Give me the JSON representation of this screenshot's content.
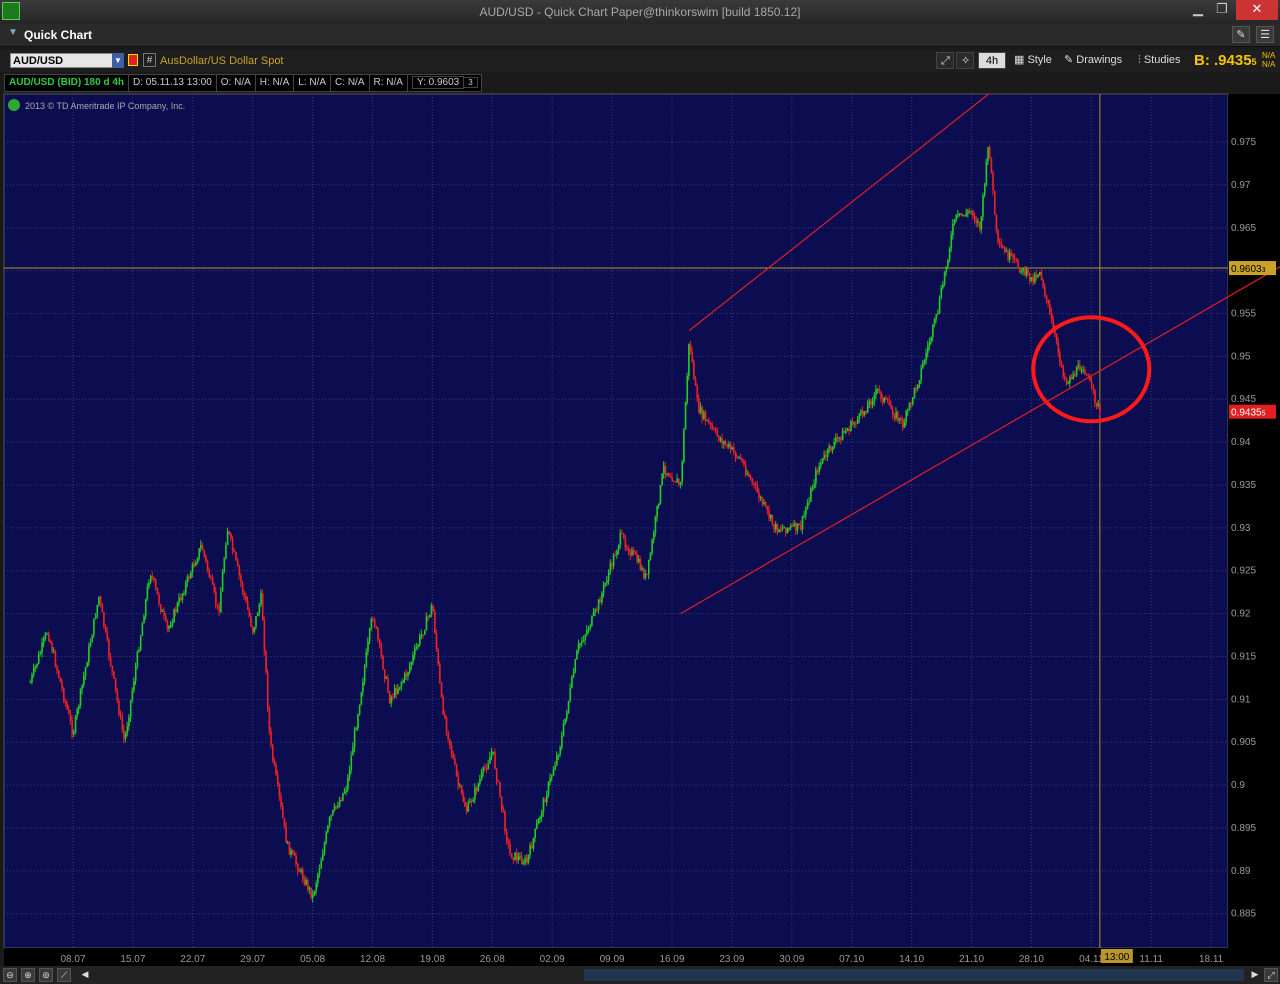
{
  "window": {
    "title": "AUD/USD - Quick Chart Paper@thinkorswim [build 1850.12]"
  },
  "header": {
    "label": "Quick Chart"
  },
  "toolbar": {
    "symbol": "AUD/USD",
    "description": "AusDollar/US Dollar Spot",
    "timeframe": "4h",
    "style_label": "Style",
    "drawings_label": "Drawings",
    "studies_label": "Studies",
    "bid_label": "B:",
    "bid_value": ".9435",
    "bid_sub": "5",
    "na_top": "N/A",
    "na_bottom": "N/A"
  },
  "info": {
    "symbol": "AUD/USD (BID) 180 d 4h",
    "date": "D: 05.11.13 13:00",
    "open": "O: N/A",
    "high": "H: N/A",
    "low": "L: N/A",
    "close": "C: N/A",
    "range": "R: N/A",
    "y": "Y: 0.9603",
    "y_sub": "3"
  },
  "copyright": "2013 © TD Ameritrade IP Company, Inc.",
  "chart_data": {
    "type": "candlestick",
    "x_tick_labels": [
      "08.07",
      "15.07",
      "22.07",
      "29.07",
      "05.08",
      "12.08",
      "19.08",
      "26.08",
      "02.09",
      "09.09",
      "16.09",
      "23.09",
      "30.09",
      "07.10",
      "14.10",
      "21.10",
      "28.10",
      "04.11",
      "11.11",
      "18.11"
    ],
    "y_tick_labels": [
      "0.885",
      "0.89",
      "0.895",
      "0.9",
      "0.905",
      "0.91",
      "0.915",
      "0.92",
      "0.925",
      "0.93",
      "0.935",
      "0.94",
      "0.945",
      "0.95",
      "0.955",
      "0.96",
      "0.965",
      "0.97",
      "0.975"
    ],
    "ylim": [
      0.881,
      0.9806
    ],
    "close_path": [
      {
        "x": "03.07",
        "y": 0.912
      },
      {
        "x": "05.07",
        "y": 0.918
      },
      {
        "x": "08.07",
        "y": 0.906
      },
      {
        "x": "11.07",
        "y": 0.922
      },
      {
        "x": "14.07",
        "y": 0.905
      },
      {
        "x": "17.07",
        "y": 0.925
      },
      {
        "x": "19.07",
        "y": 0.918
      },
      {
        "x": "23.07",
        "y": 0.928
      },
      {
        "x": "25.07",
        "y": 0.92
      },
      {
        "x": "26.07",
        "y": 0.93
      },
      {
        "x": "29.07",
        "y": 0.918
      },
      {
        "x": "30.07",
        "y": 0.922
      },
      {
        "x": "31.07",
        "y": 0.905
      },
      {
        "x": "01.08",
        "y": 0.899
      },
      {
        "x": "02.08",
        "y": 0.893
      },
      {
        "x": "05.08",
        "y": 0.887
      },
      {
        "x": "07.08",
        "y": 0.896
      },
      {
        "x": "09.08",
        "y": 0.9
      },
      {
        "x": "12.08",
        "y": 0.92
      },
      {
        "x": "14.08",
        "y": 0.91
      },
      {
        "x": "16.08",
        "y": 0.913
      },
      {
        "x": "19.08",
        "y": 0.921
      },
      {
        "x": "20.08",
        "y": 0.91
      },
      {
        "x": "22.08",
        "y": 0.9
      },
      {
        "x": "23.08",
        "y": 0.897
      },
      {
        "x": "26.08",
        "y": 0.904
      },
      {
        "x": "28.08",
        "y": 0.892
      },
      {
        "x": "30.08",
        "y": 0.891
      },
      {
        "x": "03.09",
        "y": 0.905
      },
      {
        "x": "05.09",
        "y": 0.916
      },
      {
        "x": "07.09",
        "y": 0.92
      },
      {
        "x": "10.09",
        "y": 0.929
      },
      {
        "x": "12.09",
        "y": 0.926
      },
      {
        "x": "13.09",
        "y": 0.924
      },
      {
        "x": "15.09",
        "y": 0.937
      },
      {
        "x": "17.09",
        "y": 0.935
      },
      {
        "x": "18.09",
        "y": 0.952
      },
      {
        "x": "19.09",
        "y": 0.944
      },
      {
        "x": "21.09",
        "y": 0.941
      },
      {
        "x": "24.09",
        "y": 0.938
      },
      {
        "x": "26.09",
        "y": 0.934
      },
      {
        "x": "28.09",
        "y": 0.93
      },
      {
        "x": "01.10",
        "y": 0.93
      },
      {
        "x": "03.10",
        "y": 0.937
      },
      {
        "x": "05.10",
        "y": 0.94
      },
      {
        "x": "08.10",
        "y": 0.943
      },
      {
        "x": "10.10",
        "y": 0.946
      },
      {
        "x": "13.10",
        "y": 0.942
      },
      {
        "x": "15.10",
        "y": 0.948
      },
      {
        "x": "17.10",
        "y": 0.955
      },
      {
        "x": "19.10",
        "y": 0.966
      },
      {
        "x": "21.10",
        "y": 0.967
      },
      {
        "x": "22.10",
        "y": 0.965
      },
      {
        "x": "23.10",
        "y": 0.975
      },
      {
        "x": "24.10",
        "y": 0.963
      },
      {
        "x": "26.10",
        "y": 0.961
      },
      {
        "x": "28.10",
        "y": 0.959
      },
      {
        "x": "29.10",
        "y": 0.96
      },
      {
        "x": "31.10",
        "y": 0.951
      },
      {
        "x": "01.11",
        "y": 0.947
      },
      {
        "x": "03.11",
        "y": 0.949
      },
      {
        "x": "05.11",
        "y": 0.9435
      }
    ],
    "price_labels": [
      {
        "text": "0.9603",
        "sub": "3",
        "y": 0.9603,
        "color": "#c9a227"
      },
      {
        "text": "0.9435",
        "sub": "5",
        "y": 0.94355,
        "color": "#e02020"
      }
    ],
    "cursor": {
      "x_label": "13:00",
      "x": "05.11",
      "y": 0.9603
    },
    "annotations": {
      "channel_upper": [
        {
          "x": "18.09",
          "y": 0.953
        },
        {
          "x": "23.10",
          "y": 0.9806
        }
      ],
      "channel_lower": [
        {
          "x": "17.09",
          "y": 0.92
        },
        {
          "x": "27.11",
          "y": 0.961
        }
      ],
      "circle": {
        "x": "04.11",
        "y": 0.9485
      }
    },
    "colors": {
      "up": "#22cc22",
      "down": "#ee2222",
      "background": "#0c0c50",
      "grid": "#3a3a70",
      "channel": "#e02020"
    }
  }
}
